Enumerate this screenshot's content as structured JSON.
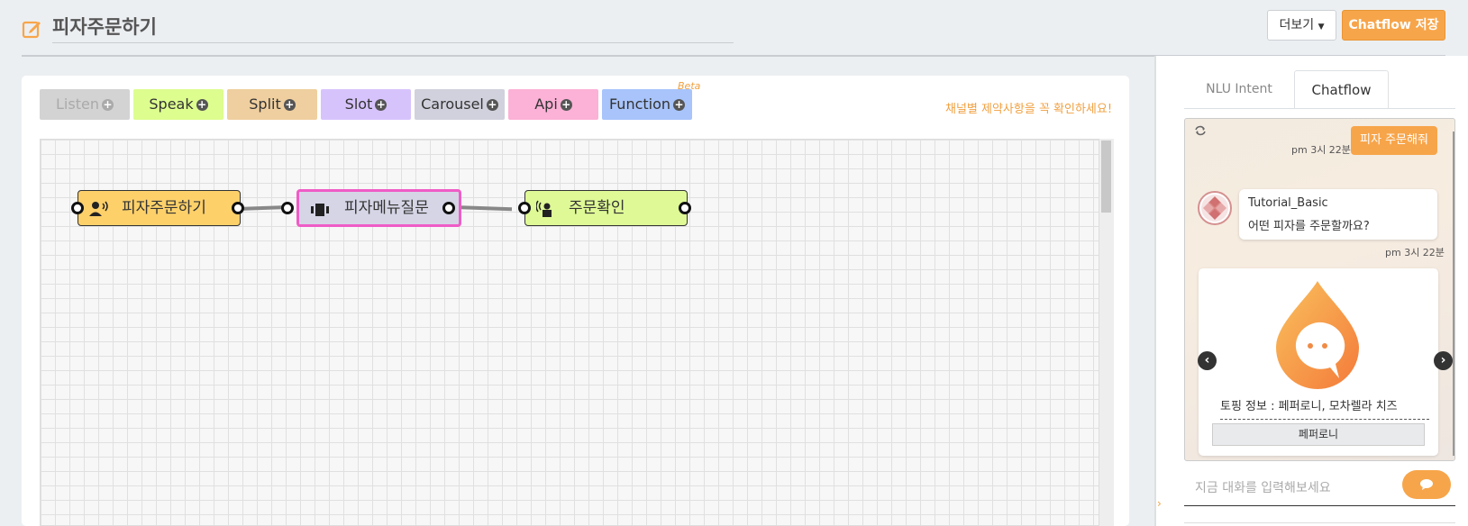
{
  "header": {
    "title": "피자주문하기",
    "more_label": "더보기",
    "save_label": "Chatflow 저장"
  },
  "toolbar": {
    "buttons": [
      {
        "label": "Listen",
        "color": "#d3d3d3"
      },
      {
        "label": "Speak",
        "color": "#ddfd8f"
      },
      {
        "label": "Split",
        "color": "#efcf9f"
      },
      {
        "label": "Slot",
        "color": "#d7c3fc"
      },
      {
        "label": "Carousel",
        "color": "#d0d1dc"
      },
      {
        "label": "Api",
        "color": "#fcb1d6"
      },
      {
        "label": "Function",
        "color": "#a8c4fb"
      }
    ],
    "beta_label": "Beta",
    "notice": "채널별 제약사항을 꼭 확인하세요!"
  },
  "flow": {
    "nodes": [
      {
        "label": "피자주문하기",
        "icon": "listen-icon"
      },
      {
        "label": "피자메뉴질문",
        "icon": "carousel-icon"
      },
      {
        "label": "주문확인",
        "icon": "speak-icon"
      }
    ]
  },
  "panel": {
    "tabs": [
      "NLU Intent",
      "Chatflow"
    ],
    "chat": {
      "user_message": "피자 주문해줘",
      "user_time": "pm 3시 22분",
      "bot_name": "Tutorial_Basic",
      "bot_message": "어떤 피자를 주문할까요?",
      "bot_time": "pm 3시 22분",
      "card_description": "토핑 정보 : 페퍼로니, 모차렐라 치즈",
      "card_button": "페퍼로니"
    },
    "input_placeholder": "지금 대화를 입력해보세요"
  },
  "colors": {
    "accent": "#f7a54a",
    "selected_border": "#ef5cc6"
  }
}
